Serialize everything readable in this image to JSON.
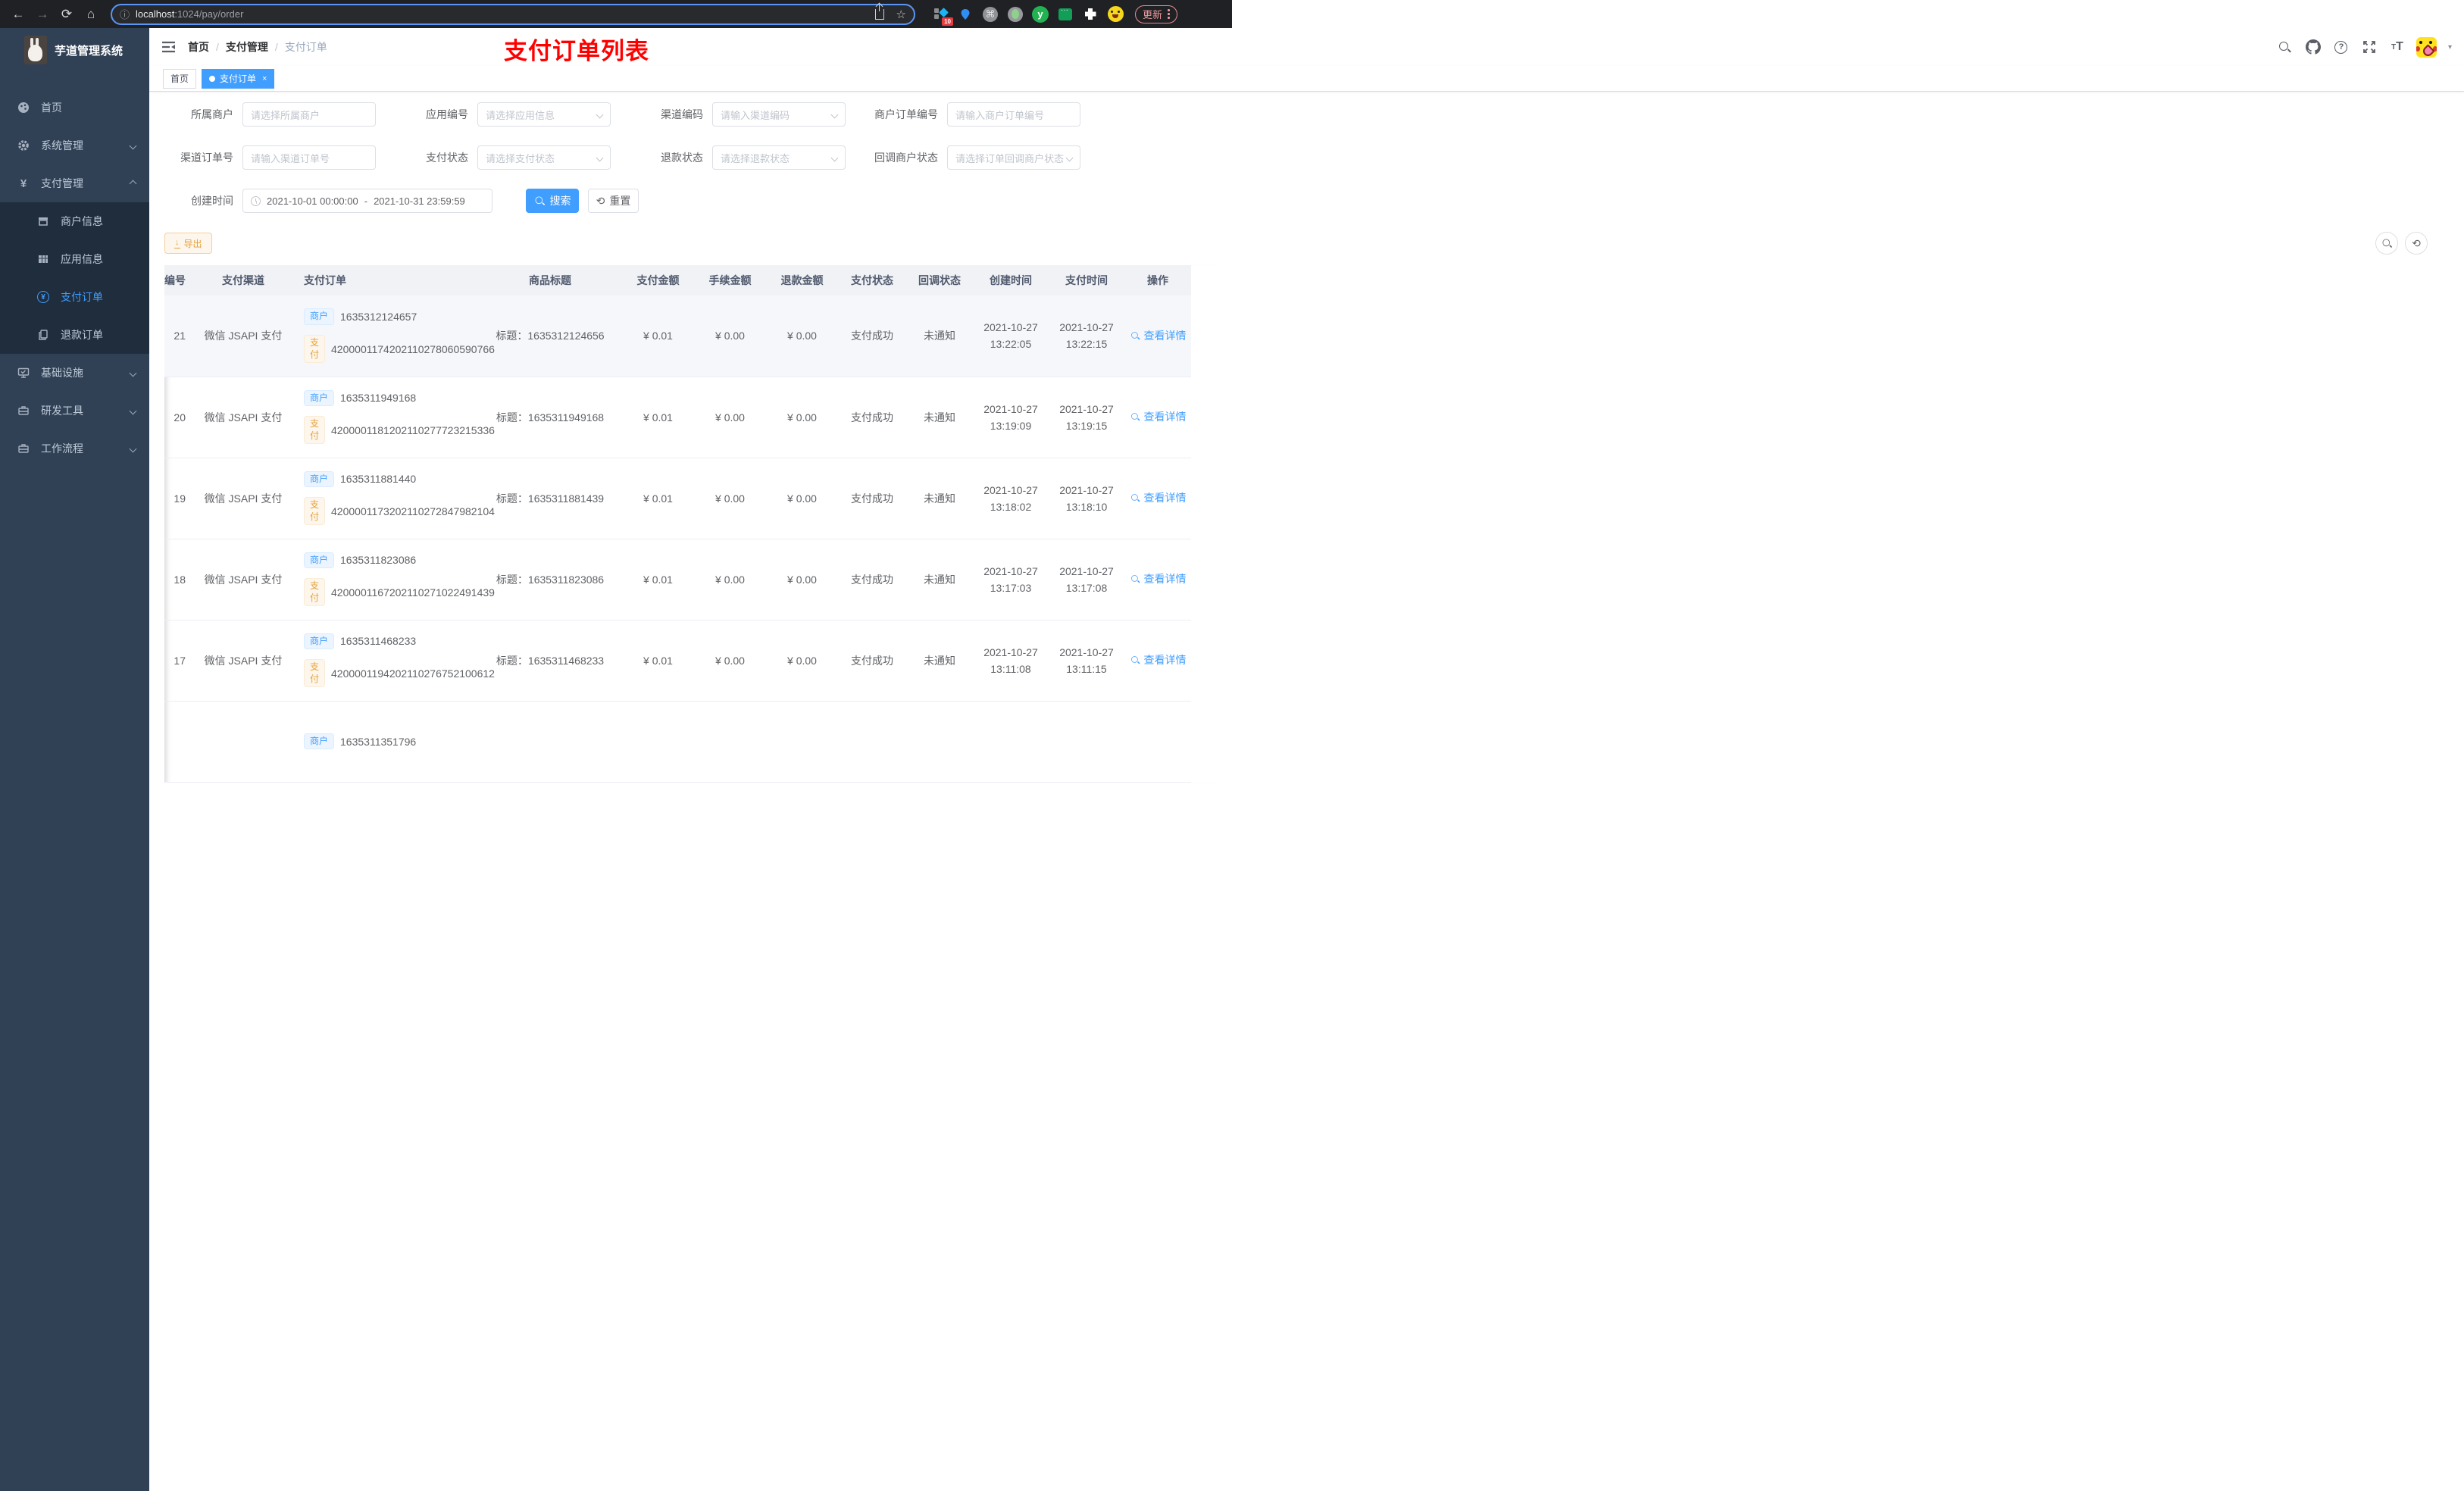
{
  "browser": {
    "url_host": "localhost",
    "url_rest": ":1024/pay/order",
    "ext_badge": "10",
    "y_ext": "y",
    "update_label": "更新"
  },
  "sidebar": {
    "title": "芋道管理系统",
    "items": [
      {
        "label": "首页"
      },
      {
        "label": "系统管理"
      },
      {
        "label": "支付管理"
      },
      {
        "label": "商户信息"
      },
      {
        "label": "应用信息"
      },
      {
        "label": "支付订单"
      },
      {
        "label": "退款订单"
      },
      {
        "label": "基础设施"
      },
      {
        "label": "研发工具"
      },
      {
        "label": "工作流程"
      }
    ]
  },
  "header": {
    "breadcrumb": [
      "首页",
      "支付管理",
      "支付订单"
    ],
    "annotation": "支付订单列表"
  },
  "tags": {
    "t0": "首页",
    "t1": "支付订单"
  },
  "filters": {
    "f0": {
      "label": "所属商户",
      "placeholder": "请选择所属商户"
    },
    "f1": {
      "label": "应用编号",
      "placeholder": "请选择应用信息"
    },
    "f2": {
      "label": "渠道编码",
      "placeholder": "请输入渠道编码"
    },
    "f3": {
      "label": "商户订单编号",
      "placeholder": "请输入商户订单编号"
    },
    "f4": {
      "label": "渠道订单号",
      "placeholder": "请输入渠道订单号"
    },
    "f5": {
      "label": "支付状态",
      "placeholder": "请选择支付状态"
    },
    "f6": {
      "label": "退款状态",
      "placeholder": "请选择退款状态"
    },
    "f7": {
      "label": "回调商户状态",
      "placeholder": "请选择订单回调商户状态"
    },
    "f8": {
      "label": "创建时间",
      "start": "2021-10-01 00:00:00",
      "separator": "-",
      "end": "2021-10-31 23:59:59"
    },
    "search_label": "搜索",
    "reset_label": "重置"
  },
  "toolbar": {
    "export_label": "导出"
  },
  "table": {
    "columns": [
      "编号",
      "支付渠道",
      "支付订单",
      "商品标题",
      "支付金额",
      "手续金额",
      "退款金额",
      "支付状态",
      "回调状态",
      "创建时间",
      "支付时间",
      "操作"
    ],
    "merchant_tag": "商户",
    "pay_tag": "支付",
    "title_prefix": "标题：",
    "action_label": "查看详情",
    "rows": [
      {
        "id": "21",
        "channel": "微信 JSAPI 支付",
        "merchant_no": "1635312124657",
        "pay_no": "4200001174202110278060590766",
        "title": "1635312124656",
        "amount": "¥ 0.01",
        "fee": "¥ 0.00",
        "refund": "¥ 0.00",
        "status": "支付成功",
        "notify": "未通知",
        "created_date": "2021-10-27",
        "created_time": "13:22:05",
        "pay_date": "2021-10-27",
        "pay_time": "13:22:15",
        "highlight": true
      },
      {
        "id": "20",
        "channel": "微信 JSAPI 支付",
        "merchant_no": "1635311949168",
        "pay_no": "4200001181202110277723215336",
        "title": "1635311949168",
        "amount": "¥ 0.01",
        "fee": "¥ 0.00",
        "refund": "¥ 0.00",
        "status": "支付成功",
        "notify": "未通知",
        "created_date": "2021-10-27",
        "created_time": "13:19:09",
        "pay_date": "2021-10-27",
        "pay_time": "13:19:15"
      },
      {
        "id": "19",
        "channel": "微信 JSAPI 支付",
        "merchant_no": "1635311881440",
        "pay_no": "4200001173202110272847982104",
        "title": "1635311881439",
        "amount": "¥ 0.01",
        "fee": "¥ 0.00",
        "refund": "¥ 0.00",
        "status": "支付成功",
        "notify": "未通知",
        "created_date": "2021-10-27",
        "created_time": "13:18:02",
        "pay_date": "2021-10-27",
        "pay_time": "13:18:10"
      },
      {
        "id": "18",
        "channel": "微信 JSAPI 支付",
        "merchant_no": "1635311823086",
        "pay_no": "4200001167202110271022491439",
        "title": "1635311823086",
        "amount": "¥ 0.01",
        "fee": "¥ 0.00",
        "refund": "¥ 0.00",
        "status": "支付成功",
        "notify": "未通知",
        "created_date": "2021-10-27",
        "created_time": "13:17:03",
        "pay_date": "2021-10-27",
        "pay_time": "13:17:08"
      },
      {
        "id": "17",
        "channel": "微信 JSAPI 支付",
        "merchant_no": "1635311468233",
        "pay_no": "4200001194202110276752100612",
        "title": "1635311468233",
        "amount": "¥ 0.01",
        "fee": "¥ 0.00",
        "refund": "¥ 0.00",
        "status": "支付成功",
        "notify": "未通知",
        "created_date": "2021-10-27",
        "created_time": "13:11:08",
        "pay_date": "2021-10-27",
        "pay_time": "13:11:15"
      },
      {
        "partial": true,
        "merchant_no": "1635311351796"
      }
    ]
  }
}
